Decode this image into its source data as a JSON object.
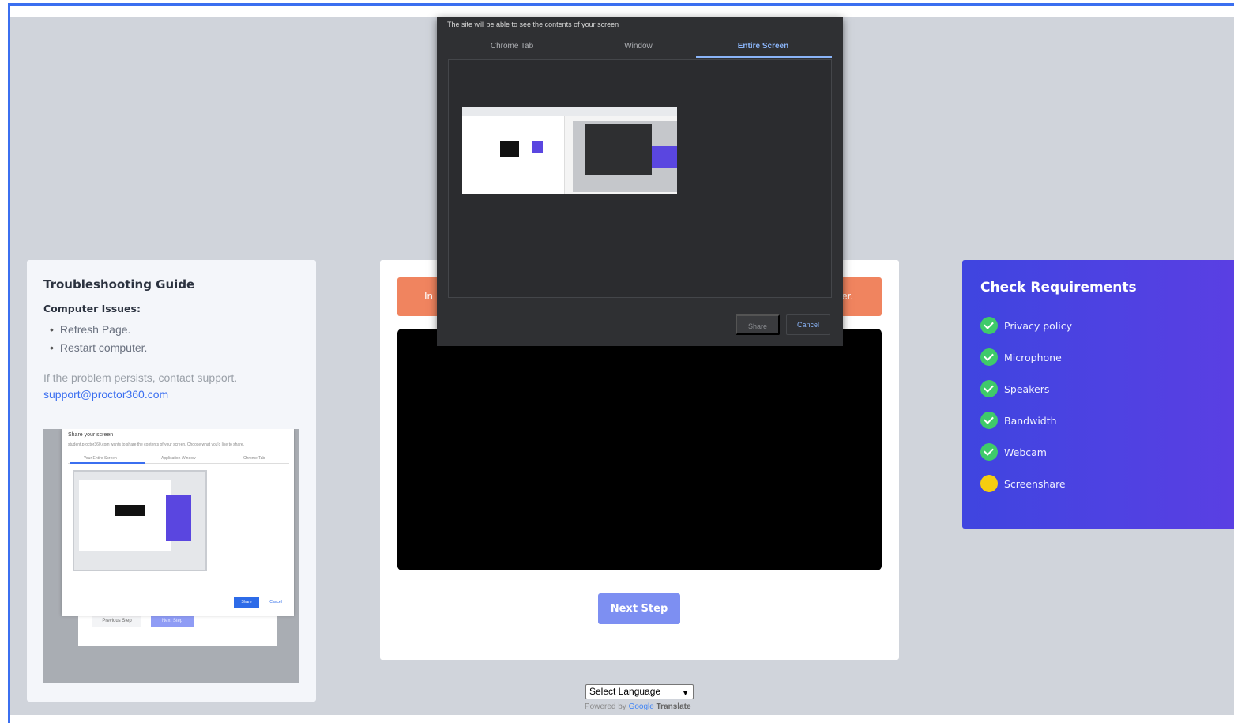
{
  "guide": {
    "title": "Troubleshooting Guide",
    "subtitle": "Computer Issues:",
    "items": [
      "Refresh Page.",
      "Restart computer."
    ],
    "note": "If the problem persists, contact support.",
    "email": "support@proctor360.com",
    "image": {
      "dialog_title": "Share your screen",
      "dialog_desc": "student.proctor360.com wants to share the contents of your screen. Choose what you'd like to share.",
      "tabs": [
        "Your Entire Screen",
        "Application Window",
        "Chrome Tab"
      ],
      "share_label": "Share",
      "cancel_label": "Cancel",
      "prev_label": "Previous Step",
      "next_label": "Next Step"
    }
  },
  "main": {
    "alert_left": "In",
    "alert_right": "er.",
    "next_label": "Next Step"
  },
  "requirements": {
    "title": "Check Requirements",
    "items": [
      {
        "label": "Privacy policy",
        "status": "done"
      },
      {
        "label": "Microphone",
        "status": "done"
      },
      {
        "label": "Speakers",
        "status": "done"
      },
      {
        "label": "Bandwidth",
        "status": "done"
      },
      {
        "label": "Webcam",
        "status": "done"
      },
      {
        "label": "Screenshare",
        "status": "pending"
      }
    ]
  },
  "share_dialog": {
    "title": "The site will be able to see the contents of your screen",
    "tabs": [
      "Chrome Tab",
      "Window",
      "Entire Screen"
    ],
    "active_tab": "Entire Screen",
    "share_label": "Share",
    "cancel_label": "Cancel"
  },
  "language": {
    "selected": "Select Language",
    "powered_prefix": "Powered by",
    "powered_google": "Google",
    "powered_suffix": "Translate"
  },
  "colors": {
    "accent": "#3b6ff0",
    "alert": "#f0845f",
    "check": "#3fca6a",
    "pending": "#f5cd10",
    "requirements_bg": "#4a43e2"
  }
}
